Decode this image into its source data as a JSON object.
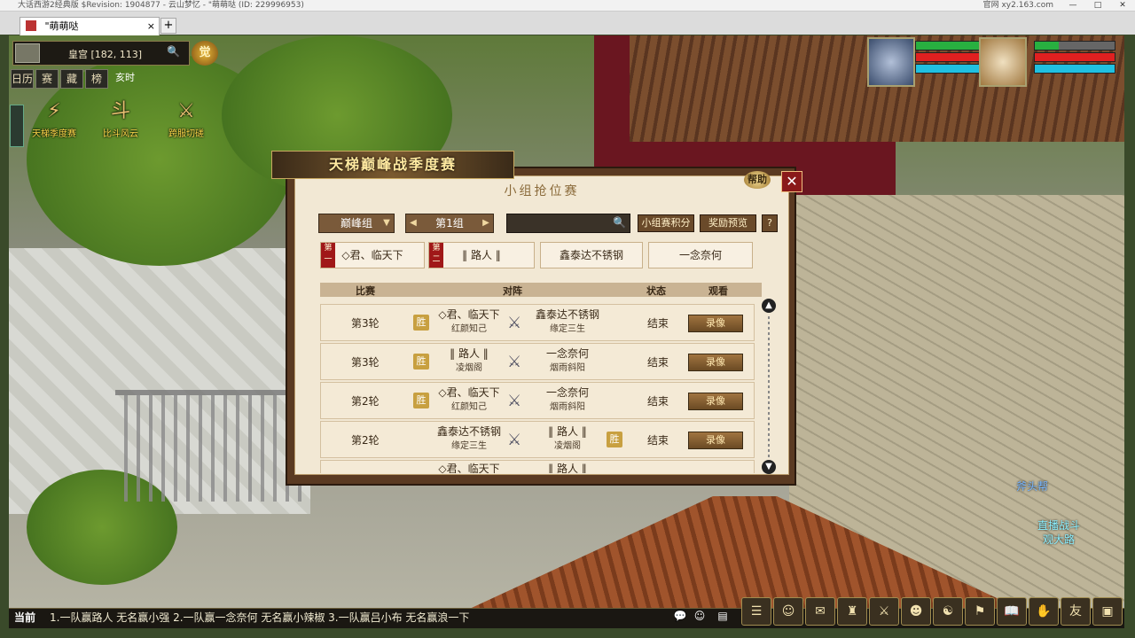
{
  "window": {
    "title": "大话西游2经典版 $Revision: 1904877 - 云山梦忆 - \"萌萌哒 (ID: 229996953)",
    "right_text": "官网 xy2.163.com",
    "tab_title": "\"萌萌哒",
    "tab_close": "×",
    "tab_add": "+",
    "buttons": [
      "—",
      "□",
      "✕"
    ]
  },
  "hud": {
    "location": "皇宫 [182, 113]",
    "search_icon": "🔍",
    "badge": "觉",
    "buttons": [
      "日历",
      "赛",
      "藏",
      "榜"
    ],
    "time": "亥时",
    "events": [
      "天梯季度赛",
      "比斗风云",
      "跨服切磋"
    ]
  },
  "dialog": {
    "banner": "天梯巅峰战季度赛",
    "subtitle": "小组抢位赛",
    "help": "帮助",
    "close": "✕",
    "group_select": "巅峰组",
    "group_no": "第1组",
    "search_icon": "🔍",
    "buttons": [
      "小组赛积分",
      "奖励预览",
      "?"
    ],
    "teams": [
      {
        "rank": "第一",
        "name": "◇君、临天下"
      },
      {
        "rank": "第二",
        "name": "‖ 路人 ‖"
      },
      {
        "rank": "",
        "name": "鑫泰达不锈钢"
      },
      {
        "rank": "",
        "name": "一念奈何"
      }
    ],
    "headers": [
      "比赛",
      "对阵",
      "状态",
      "观看"
    ],
    "win_label": "胜",
    "rows": [
      {
        "round": "第3轮",
        "a": "◇君、临天下",
        "a_sub": "红颜知己",
        "b": "鑫泰达不锈钢",
        "b_sub": "缘定三生",
        "winner": "a",
        "status": "结束",
        "btn": "录像"
      },
      {
        "round": "第3轮",
        "a": "‖ 路人 ‖",
        "a_sub": "凌烟阁",
        "b": "一念奈何",
        "b_sub": "烟雨斜阳",
        "winner": "a",
        "status": "结束",
        "btn": "录像"
      },
      {
        "round": "第2轮",
        "a": "◇君、临天下",
        "a_sub": "红颜知己",
        "b": "一念奈何",
        "b_sub": "烟雨斜阳",
        "winner": "a",
        "status": "结束",
        "btn": "录像"
      },
      {
        "round": "第2轮",
        "a": "鑫泰达不锈钢",
        "a_sub": "缘定三生",
        "b": "‖ 路人 ‖",
        "b_sub": "凌烟阁",
        "winner": "b",
        "status": "结束",
        "btn": "录像"
      }
    ],
    "partial_row": "◇君、临天下",
    "partial_row_b": "‖ 路人 ‖"
  },
  "npc": {
    "name": "斧头帮",
    "label1": "直播战斗",
    "label2": "观大路"
  },
  "bottom": {
    "current": "当前",
    "message": "1.一队赢路人   无名赢小强   2.一队赢一念奈何  无名赢小辣椒  3.一队赢吕小布  无名赢浪一下"
  },
  "toolbar": [
    "☰",
    "☺",
    "✉",
    "♜",
    "⚔",
    "☻",
    "☯",
    "⚑",
    "📖",
    "✋",
    "友",
    "▣"
  ],
  "colors": {
    "hp": "#e02020",
    "mp": "#20c0e0",
    "frame": "#5a3a22",
    "paper": "#f2e8d4"
  }
}
